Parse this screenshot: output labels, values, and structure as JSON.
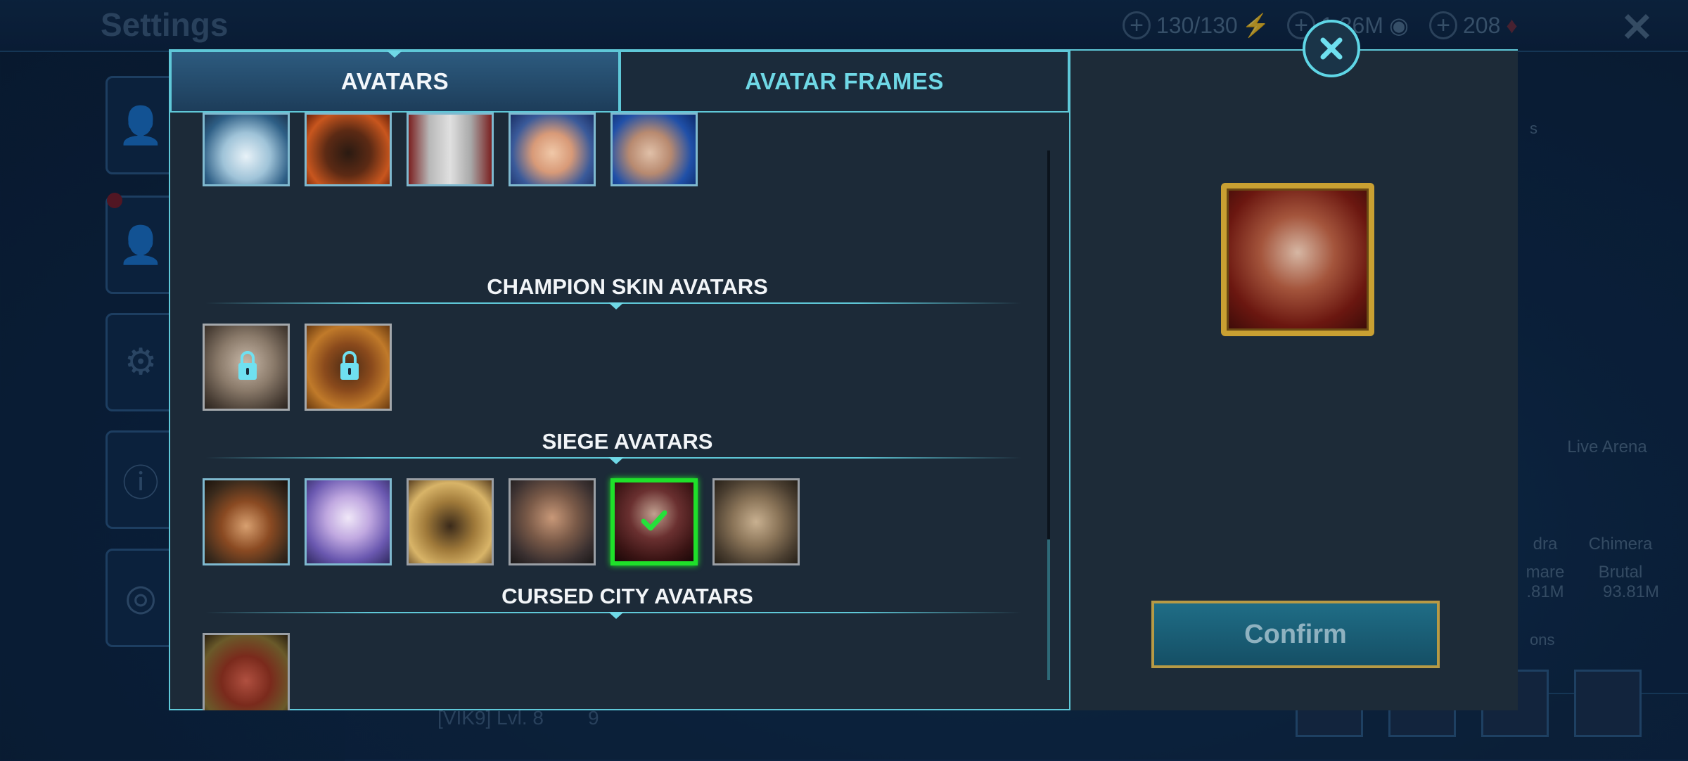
{
  "background": {
    "title": "Settings",
    "resources": [
      {
        "value": "130/130",
        "icon": "energy-icon"
      },
      {
        "value": "1.36M",
        "icon": "silver-icon"
      },
      {
        "value": "208",
        "icon": "gem-icon"
      }
    ],
    "right_panel": {
      "live_arena_label": "Live Arena",
      "col1_title": "dra",
      "col1_sub": "mare",
      "col1_value": ".81M",
      "col2_title": "Chimera",
      "col2_sub": "Brutal",
      "col2_value": "93.81M",
      "top_field": "s",
      "bottom_field": "ons"
    },
    "clan_text": "[VIK9] Lvl. 8",
    "clan_number": "9"
  },
  "modal": {
    "tabs": [
      {
        "label": "AVATARS",
        "active": true
      },
      {
        "label": "AVATAR FRAMES",
        "active": false
      }
    ],
    "sections": [
      {
        "title": "CHAMPION SKIN AVATARS"
      },
      {
        "title": "SIEGE AVATARS"
      },
      {
        "title": "CURSED CITY AVATARS"
      }
    ],
    "confirm_label": "Confirm",
    "colors": {
      "accent": "#5fc8d8",
      "selected": "#1fe02a",
      "panel": "#1c2a38",
      "frame_gold": "#c9a032"
    }
  }
}
